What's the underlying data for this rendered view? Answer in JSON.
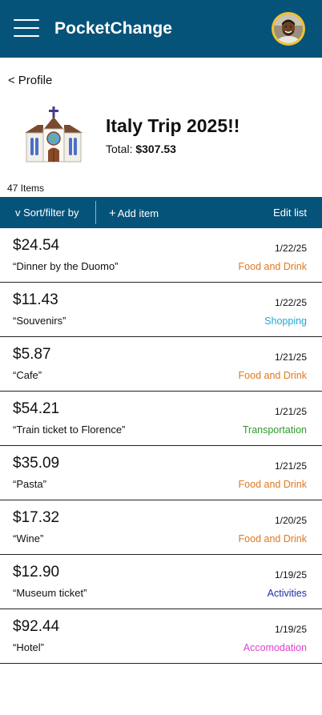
{
  "app": {
    "title": "PocketChange",
    "menu_icon": "hamburger-menu-icon",
    "avatar_icon": "user-avatar"
  },
  "nav": {
    "back_chevron": "<",
    "back_label": "Profile"
  },
  "trip": {
    "icon": "church-icon",
    "title": "Italy Trip 2025!!",
    "total_label": "Total: ",
    "total_value": "$307.53"
  },
  "list_meta": {
    "item_count": "47 Items"
  },
  "toolbar": {
    "sort_label": "v Sort/filter by",
    "add_plus": "+",
    "add_label": "Add item",
    "edit_label": "Edit list"
  },
  "category_colors": {
    "Food and Drink": "#e0781e",
    "Shopping": "#23a6d8",
    "Transportation": "#2e9c2a",
    "Activities": "#1c2fa8",
    "Accomodation": "#e13fd0"
  },
  "expenses": [
    {
      "amount": "$24.54",
      "description": "“Dinner by the Duomo”",
      "date": "1/22/25",
      "category": "Food and Drink"
    },
    {
      "amount": "$11.43",
      "description": "“Souvenirs”",
      "date": "1/22/25",
      "category": "Shopping"
    },
    {
      "amount": "$5.87",
      "description": "“Cafe”",
      "date": "1/21/25",
      "category": "Food and Drink"
    },
    {
      "amount": "$54.21",
      "description": "“Train ticket to Florence”",
      "date": "1/21/25",
      "category": "Transportation"
    },
    {
      "amount": "$35.09",
      "description": "“Pasta”",
      "date": "1/21/25",
      "category": "Food and Drink"
    },
    {
      "amount": "$17.32",
      "description": "“Wine”",
      "date": "1/20/25",
      "category": "Food and Drink"
    },
    {
      "amount": "$12.90",
      "description": "“Museum ticket”",
      "date": "1/19/25",
      "category": "Activities"
    },
    {
      "amount": "$92.44",
      "description": "“Hotel”",
      "date": "1/19/25",
      "category": "Accomodation"
    }
  ]
}
